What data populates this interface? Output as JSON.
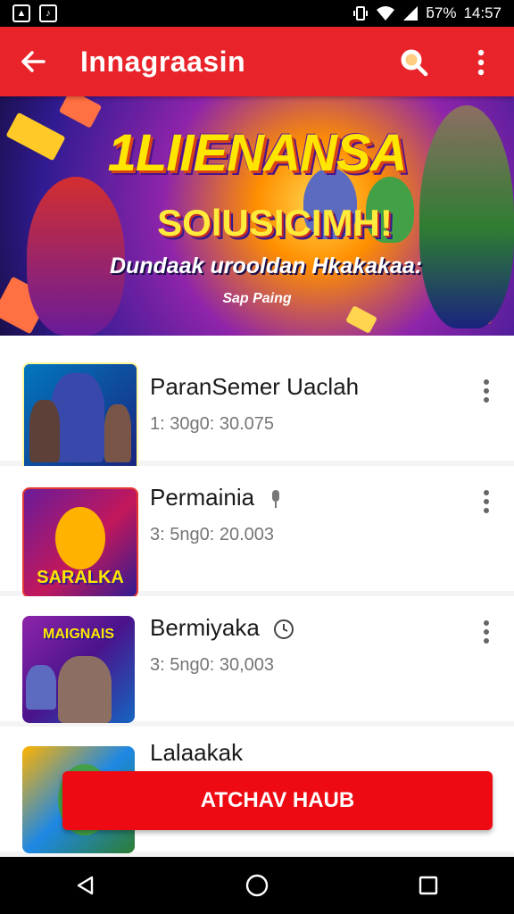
{
  "status_bar": {
    "battery": "⁠ƃ7%",
    "time": "14:57"
  },
  "app_bar": {
    "title": "Innagraasin"
  },
  "banner": {
    "title": "1LIIENANSA",
    "subtitle": "SOlUSICIMH!",
    "tagline": "Dundaak urooldan Hkakakaa:",
    "small_text": "Sap Paing"
  },
  "items": [
    {
      "title": "ParanSemer Uaclah",
      "meta": "1: 30g0: 30.075",
      "thumb_label": ""
    },
    {
      "title": "Permainia",
      "meta": "3: 5ng0: 20.003",
      "thumb_label": "SARALKA"
    },
    {
      "title": "Bermiyaka",
      "meta": "3: 5ng0: 30,003",
      "thumb_label": "MAIGNAIS"
    },
    {
      "title": "Lalaakak",
      "meta": "",
      "thumb_label": ""
    }
  ],
  "cta": {
    "label": "ATCHAV HAUB"
  },
  "colors": {
    "primary": "#e8242a",
    "cta": "#ee0a12"
  },
  "icons": {
    "back": "arrow-back-icon",
    "search": "search-icon",
    "more": "more-vert-icon"
  }
}
